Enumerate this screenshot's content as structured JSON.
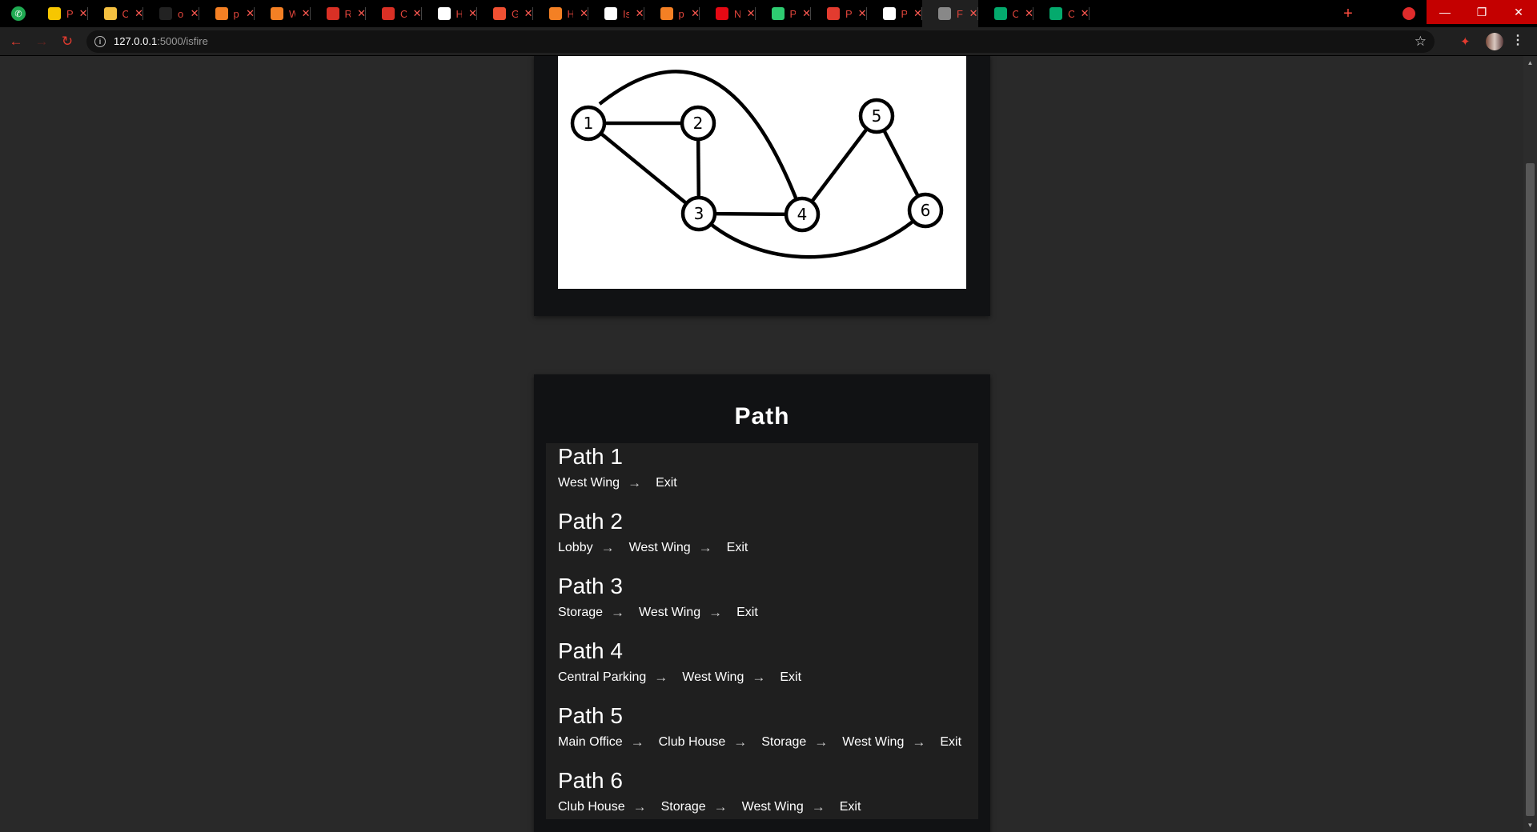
{
  "browser": {
    "pinned_tab": {
      "icon": "whatsapp-icon"
    },
    "tabs": [
      {
        "label": "Prin",
        "icon": "notes-icon",
        "color": "#f7c600"
      },
      {
        "label": "Cop",
        "icon": "smiley-icon",
        "color": "#f4c040"
      },
      {
        "label": "old",
        "icon": "github-icon",
        "color": "#222222"
      },
      {
        "label": "pyt",
        "icon": "stackoverflow-icon",
        "color": "#f48024"
      },
      {
        "label": "Wh",
        "icon": "stackoverflow-icon",
        "color": "#f48024"
      },
      {
        "label": "Re:",
        "icon": "gmail-icon",
        "color": "#d93025"
      },
      {
        "label": "Cor",
        "icon": "gmail-icon",
        "color": "#d93025"
      },
      {
        "label": "Hov",
        "icon": "medium-icon",
        "color": "#ffffff"
      },
      {
        "label": "Git",
        "icon": "git-icon",
        "color": "#f05032"
      },
      {
        "label": "Hov",
        "icon": "stackoverflow-icon",
        "color": "#f48024"
      },
      {
        "label": "Is in",
        "icon": "google-icon",
        "color": "#ffffff"
      },
      {
        "label": "pyt",
        "icon": "stackoverflow-icon",
        "color": "#f48024"
      },
      {
        "label": "Net",
        "icon": "netflix-icon",
        "color": "#e50914"
      },
      {
        "label": "Pyt",
        "icon": "circle-icon",
        "color": "#2ecc71"
      },
      {
        "label": "Pre",
        "icon": "power-icon",
        "color": "#e33b2f"
      },
      {
        "label": "Pro",
        "icon": "code-icon",
        "color": "#ffffff"
      },
      {
        "label": "Fire",
        "icon": "globe-icon",
        "color": "#888888",
        "active": true
      },
      {
        "label": "CSS",
        "icon": "w3schools-icon",
        "color": "#04aa6d"
      },
      {
        "label": "CSS",
        "icon": "w3schools-icon",
        "color": "#04aa6d"
      }
    ],
    "new_tab_label": "+",
    "url_host": "127.0.0.1",
    "url_rest": ":5000/isfire",
    "window_controls": {
      "minimize": "—",
      "restore": "❐",
      "close": "✕"
    }
  },
  "graph": {
    "nodes": [
      {
        "id": "1",
        "label": "1"
      },
      {
        "id": "2",
        "label": "2"
      },
      {
        "id": "3",
        "label": "3"
      },
      {
        "id": "4",
        "label": "4"
      },
      {
        "id": "5",
        "label": "5"
      },
      {
        "id": "6",
        "label": "6"
      }
    ],
    "edges": [
      [
        "1",
        "2"
      ],
      [
        "1",
        "3"
      ],
      [
        "2",
        "3"
      ],
      [
        "3",
        "4"
      ],
      [
        "1",
        "4"
      ],
      [
        "4",
        "5"
      ],
      [
        "5",
        "6"
      ],
      [
        "3",
        "6"
      ]
    ]
  },
  "path_section": {
    "title": "Path",
    "paths": [
      {
        "name": "Path 1",
        "stops": [
          "West Wing",
          "Exit"
        ]
      },
      {
        "name": "Path 2",
        "stops": [
          "Lobby",
          "West Wing",
          "Exit"
        ]
      },
      {
        "name": "Path 3",
        "stops": [
          "Storage",
          "West Wing",
          "Exit"
        ]
      },
      {
        "name": "Path 4",
        "stops": [
          "Central Parking",
          "West Wing",
          "Exit"
        ]
      },
      {
        "name": "Path 5",
        "stops": [
          "Main Office",
          "Club House",
          "Storage",
          "West Wing",
          "Exit"
        ]
      },
      {
        "name": "Path 6",
        "stops": [
          "Club House",
          "Storage",
          "West Wing",
          "Exit"
        ]
      }
    ],
    "arrow_symbol": "→"
  }
}
